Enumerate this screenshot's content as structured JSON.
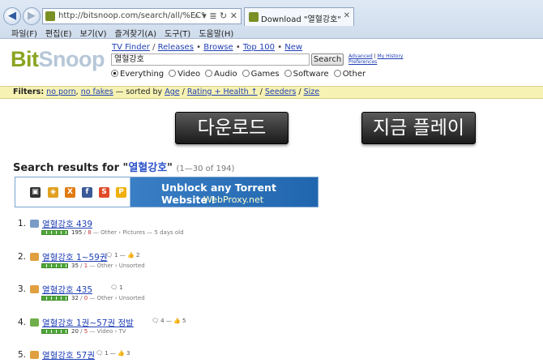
{
  "browser": {
    "url": "http://bitsnoop.com/search/all/%EC%97%84%E",
    "addr_controls": "⌕ ▾ ≣ ↻ ✕",
    "tab_title": "Download \"열혈강호\" torre...",
    "menu": [
      "파일(F)",
      "편집(E)",
      "보기(V)",
      "즐겨찾기(A)",
      "도구(T)",
      "도움말(H)"
    ]
  },
  "logo": {
    "bit": "Bit",
    "snoop": "Snoop"
  },
  "topnav": [
    "TV Finder",
    "Releases",
    "Browse",
    "Top 100",
    "New"
  ],
  "search": {
    "query": "열혈강호",
    "button": "Search",
    "advanced": "Advanced",
    "history": "My History",
    "preferences": "Preferences",
    "categories": [
      {
        "label": "Everything",
        "selected": true
      },
      {
        "label": "Video",
        "selected": false
      },
      {
        "label": "Audio",
        "selected": false
      },
      {
        "label": "Games",
        "selected": false
      },
      {
        "label": "Software",
        "selected": false
      },
      {
        "label": "Other",
        "selected": false
      }
    ]
  },
  "filters": {
    "prefix": "Filters:",
    "no_porn": "no porn",
    "no_fakes": "no fakes",
    "sorted_by": "— sorted by",
    "age": "Age",
    "rating": "Rating + Health ↑",
    "seeders": "Seeders",
    "size": "Size"
  },
  "big_buttons": {
    "download": "다운로드",
    "play_now": "지금 플레이"
  },
  "results_heading": {
    "prefix": "Search results for \"",
    "query": "열혈강호",
    "suffix": "\"",
    "count": "(1—30 of 194)"
  },
  "banner": {
    "line1": "Unblock any Torrent Website !",
    "line2": "WebProxy.net",
    "icon_labels": [
      "▣",
      "◈",
      "X",
      "f",
      "S",
      "P"
    ],
    "icon_colors": [
      "#333333",
      "#e0a020",
      "#e07a10",
      "#3b5998",
      "#e04a2a",
      "#f0b010"
    ]
  },
  "results": [
    {
      "num": "1.",
      "title": "열혈강호 439",
      "extra": "",
      "seeders": "195",
      "leechers": "8",
      "category": "— Other › Pictures — 5 days old",
      "icon_color": "#7a9cc6"
    },
    {
      "num": "2.",
      "title": "열혈강호 1~59권",
      "extra": "🗨 1 — 👍 2",
      "seeders": "35",
      "leechers": "1",
      "category": "— Other › Unsorted",
      "icon_color": "#e0a040"
    },
    {
      "num": "3.",
      "title": "열혈강호 435",
      "extra": "🗨 1",
      "seeders": "32",
      "leechers": "0",
      "category": "— Other › Unsorted",
      "icon_color": "#e0a040"
    },
    {
      "num": "4.",
      "title": "열혈강호 1권~57권 정발",
      "extra": "🗨 4 — 👍 5",
      "seeders": "20",
      "leechers": "5",
      "category": "— Video › TV",
      "icon_color": "#6fae4a"
    },
    {
      "num": "5.",
      "title": "열혈강호 57권",
      "extra": "🗨 1 — 👍 3",
      "seeders": "",
      "leechers": "",
      "category": "",
      "icon_color": "#e0a040"
    }
  ]
}
